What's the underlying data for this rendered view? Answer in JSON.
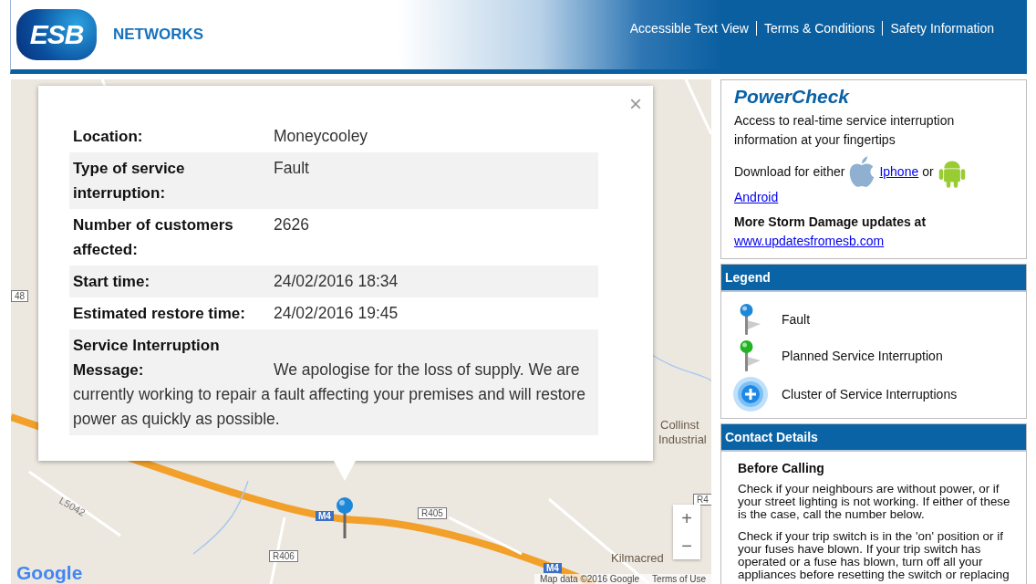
{
  "header": {
    "logo_mark": "ESB",
    "logo_text": "NETWORKS",
    "links": [
      "Accessible Text View",
      "Terms & Conditions",
      "Safety Information"
    ]
  },
  "map": {
    "labels": [
      {
        "text": "48",
        "kind": "road"
      },
      {
        "text": "Collinst",
        "kind": "place"
      },
      {
        "text": "Industrial",
        "kind": "place"
      },
      {
        "text": "L5042",
        "kind": "minor"
      },
      {
        "text": "M4",
        "kind": "motorway"
      },
      {
        "text": "R405",
        "kind": "road"
      },
      {
        "text": "R406",
        "kind": "road"
      },
      {
        "text": "R4",
        "kind": "road"
      },
      {
        "text": "Kilmacred",
        "kind": "place"
      },
      {
        "text": "M4",
        "kind": "motorway"
      }
    ],
    "zoom_in": "+",
    "zoom_out": "−",
    "brand": "Google",
    "attribution": "Map data ©2016 Google",
    "terms": "Terms of Use"
  },
  "popup": {
    "close": "×",
    "rows": [
      {
        "label": "Location:",
        "value": "Moneycooley"
      },
      {
        "label": "Type of service interruption:",
        "value": "Fault"
      },
      {
        "label": "Number of customers affected:",
        "value": "2626"
      },
      {
        "label": "Start time:",
        "value": "24/02/2016 18:34"
      },
      {
        "label": "Estimated restore time:",
        "value": "24/02/2016 19:45"
      },
      {
        "label": "Service Interruption Message:",
        "value": "We apologise for the loss of supply. We are currently working to repair a fault affecting your premises and will restore power as quickly as possible.",
        "kind": "message"
      }
    ]
  },
  "powercheck": {
    "title": "PowerCheck",
    "intro": "Access to real-time service interruption information at your fingertips",
    "download": "Download for either",
    "iphone": "Iphone",
    "or": "or",
    "android": "Android",
    "more": "More Storm Damage updates at",
    "link": "www.updatesfromesb.com"
  },
  "legend": {
    "title": "Legend",
    "items": [
      {
        "label": "Fault",
        "kind": "pin",
        "color": "#1e88d8"
      },
      {
        "label": "Planned Service Interruption",
        "kind": "pin",
        "color": "#22b422"
      },
      {
        "label": "Cluster of Service Interruptions",
        "kind": "cluster"
      }
    ]
  },
  "contact": {
    "title": "Contact Details",
    "subtitle": "Before Calling",
    "paragraphs": [
      "Check if your neighbours are without power, or if your street lighting is not working. If either of these is the case, call the number below.",
      "Check if your trip switch is in the 'on' position or if your fuses have blown. If your trip switch has operated or a fuse has blown, turn off all your appliances before resetting the switch or replacing"
    ]
  }
}
